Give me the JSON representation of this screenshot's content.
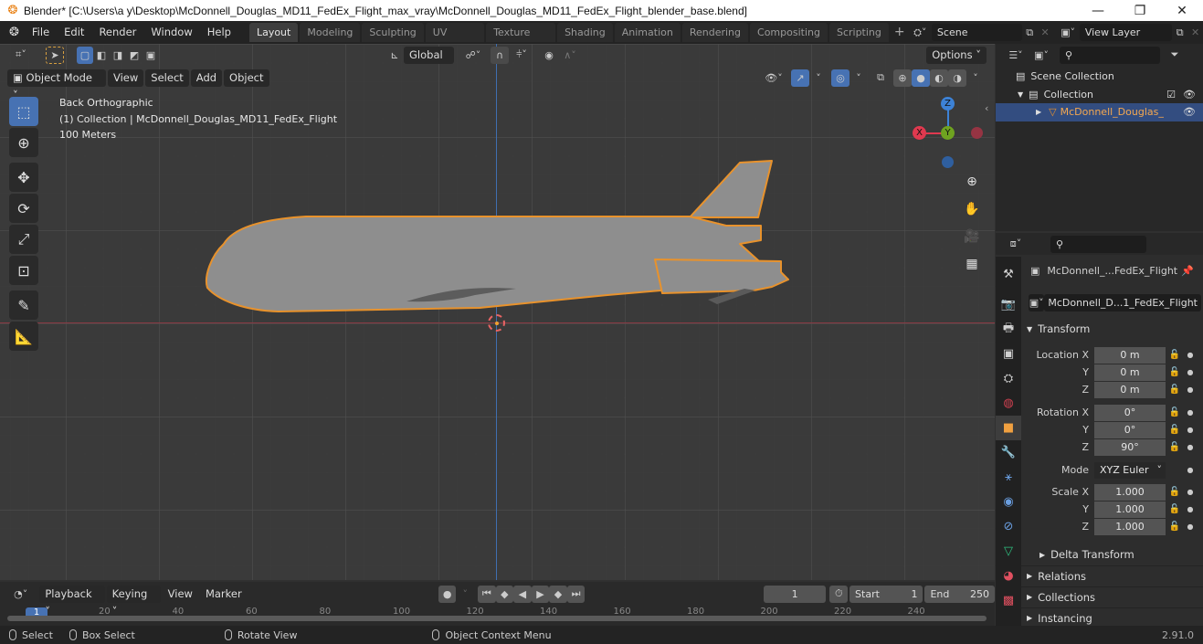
{
  "window": {
    "title": "Blender* [C:\\Users\\a y\\Desktop\\McDonnell_Douglas_MD11_FedEx_Flight_max_vray\\McDonnell_Douglas_MD11_FedEx_Flight_blender_base.blend]",
    "minimize": "—",
    "maximize": "❐",
    "close": "✕"
  },
  "menu": [
    "File",
    "Edit",
    "Render",
    "Window",
    "Help"
  ],
  "workspaces": [
    {
      "label": "Layout",
      "active": true
    },
    {
      "label": "Modeling"
    },
    {
      "label": "Sculpting"
    },
    {
      "label": "UV Editing"
    },
    {
      "label": "Texture Paint"
    },
    {
      "label": "Shading"
    },
    {
      "label": "Animation"
    },
    {
      "label": "Rendering"
    },
    {
      "label": "Compositing"
    },
    {
      "label": "Scripting"
    }
  ],
  "add_workspace": "+",
  "scene": {
    "name": "Scene"
  },
  "view_layer": {
    "name": "View Layer"
  },
  "viewport": {
    "mode": "Object Mode",
    "header_menus": [
      "View",
      "Select",
      "Add",
      "Object"
    ],
    "transform_orientation": "Global",
    "options_label": "Options",
    "overlay_lines": [
      "Back Orthographic",
      "(1) Collection | McDonnell_Douglas_MD11_FedEx_Flight",
      "100 Meters"
    ],
    "gizmo": {
      "x": "X",
      "y": "Y",
      "z": "Z",
      "x_color": "#e0394f",
      "y_color": "#6fa320",
      "z_color": "#3d82d6"
    },
    "selection_color": "#e8922c"
  },
  "outliner": {
    "search_placeholder": "",
    "items": [
      {
        "label": "Scene Collection",
        "level": 0
      },
      {
        "label": "Collection",
        "level": 1,
        "checked": true
      },
      {
        "label": "McDonnell_Douglas_",
        "level": 2,
        "selected": true
      }
    ]
  },
  "properties": {
    "search_placeholder": "",
    "object_name": "McDonnell_...FedEx_Flight",
    "datablock_name": "McDonnell_D...1_FedEx_Flight",
    "transform_label": "Transform",
    "location": {
      "label": "Location X",
      "x": "0 m",
      "y": "0 m",
      "z": "0 m"
    },
    "rotation": {
      "label": "Rotation X",
      "x": "0°",
      "y": "0°",
      "z": "90°"
    },
    "mode": {
      "label": "Mode",
      "value": "XYZ Euler"
    },
    "scale": {
      "label": "Scale X",
      "x": "1.000",
      "y": "1.000",
      "z": "1.000"
    },
    "axis_y": "Y",
    "axis_z": "Z",
    "subsections": [
      "Delta Transform"
    ],
    "sections": [
      "Relations",
      "Collections",
      "Instancing"
    ]
  },
  "timeline": {
    "menus": [
      "Playback",
      "Keying",
      "View",
      "Marker"
    ],
    "current_frame": "1",
    "start_label": "Start",
    "start": "1",
    "end_label": "End",
    "end": "250",
    "ruler_ticks": [
      "20",
      "40",
      "60",
      "80",
      "100",
      "120",
      "140",
      "160",
      "180",
      "200",
      "220",
      "240"
    ],
    "playhead": "1"
  },
  "statusbar": {
    "items": [
      "Select",
      "Box Select",
      "Rotate View",
      "Object Context Menu"
    ],
    "version": "2.91.0"
  }
}
